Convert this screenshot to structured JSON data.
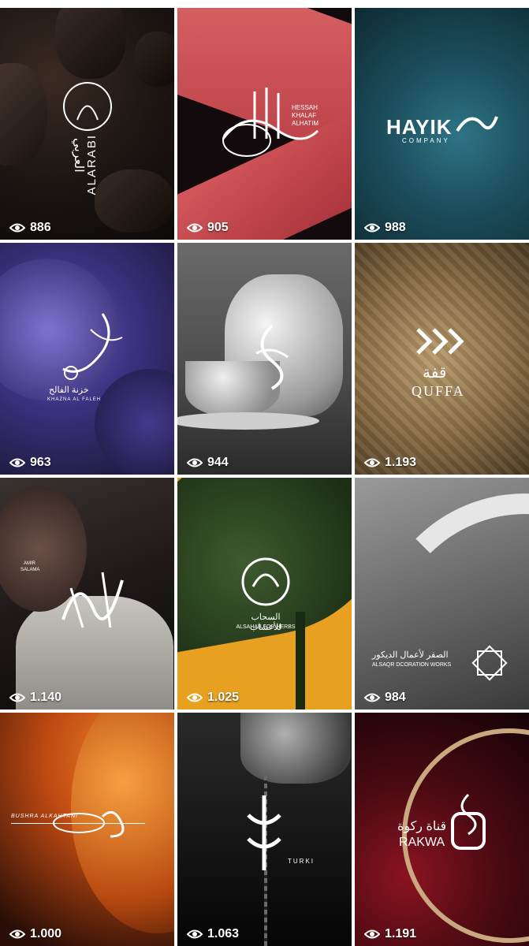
{
  "posts": [
    {
      "name": "alarabi",
      "views": "886",
      "logo_text": "ALARABI",
      "arabic_text": "العربي"
    },
    {
      "name": "hessah",
      "views": "905",
      "logo_lines": [
        "HESSAH",
        "KHALAF",
        "ALHATIM"
      ]
    },
    {
      "name": "hayik",
      "views": "988",
      "logo_text": "HAYIK",
      "sub_text": "COMPANY"
    },
    {
      "name": "khazna",
      "views": "963",
      "arabic_text": "خزنة الفالح",
      "logo_text": "KHAZNA AL FALEH"
    },
    {
      "name": "teapot",
      "views": "944"
    },
    {
      "name": "quffa",
      "views": "1.193",
      "arabic_text": "قفة",
      "logo_text": "QUFFA"
    },
    {
      "name": "amir",
      "views": "1.140",
      "logo_lines": [
        "AMIR",
        "SALAMA"
      ]
    },
    {
      "name": "alsahab",
      "views": "1.025",
      "arabic_text": "السحاب للأعشاب",
      "logo_text": "ALSAHAB FOR HERBS"
    },
    {
      "name": "alsaqr",
      "views": "984",
      "arabic_text": "الصقر لأعمال الديكور",
      "logo_text": "ALSAQR DCORATION WORKS"
    },
    {
      "name": "bushra",
      "views": "1.000",
      "logo_text": "BUSHRA ALKAHTANI"
    },
    {
      "name": "turki",
      "views": "1.063",
      "logo_text": "TURKI"
    },
    {
      "name": "rakwa",
      "views": "1.191",
      "arabic_text": "قناة ركوة",
      "logo_text": "RAKWA"
    }
  ],
  "icons": {
    "views": "eye-icon"
  }
}
